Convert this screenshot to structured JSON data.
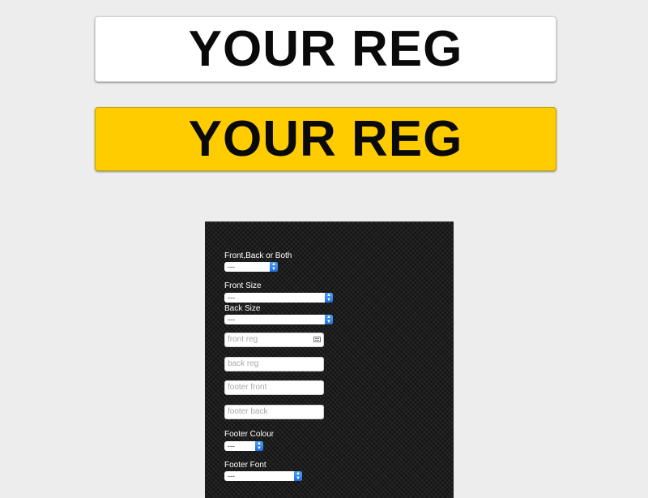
{
  "plates": {
    "front_text": "YOUR REG",
    "back_text": "YOUR REG",
    "front_color": "#ffffff",
    "back_color": "#ffcc00"
  },
  "form": {
    "side_label": "Front,Back or Both",
    "side_value": "---",
    "front_size_label": "Front Size",
    "front_size_value": "---",
    "back_size_label": "Back Size",
    "back_size_value": "---",
    "front_reg_placeholder": "front reg",
    "back_reg_placeholder": "back reg",
    "footer_front_placeholder": "footer front",
    "footer_back_placeholder": "footer back",
    "footer_colour_label": "Footer Colour",
    "footer_colour_value": "---",
    "footer_font_label": "Footer Font",
    "footer_font_value": "---"
  }
}
